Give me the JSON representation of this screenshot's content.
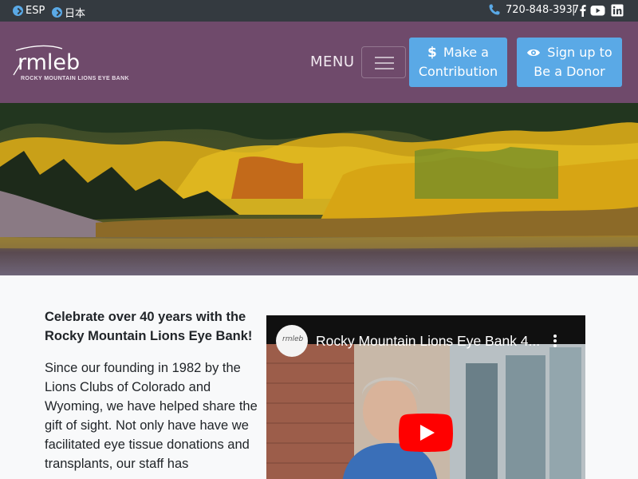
{
  "topbar": {
    "lang_esp": "ESP",
    "lang_jp": "日本",
    "phone": "720-848-3937",
    "separator": "|",
    "social": [
      "facebook-icon",
      "youtube-icon",
      "linkedin-icon"
    ]
  },
  "header": {
    "logo_text": "rmleb",
    "logo_subtitle": "ROCKY MOUNTAIN LIONS EYE BANK",
    "menu_label": "MENU",
    "contribution_line1": "Make a",
    "contribution_line2": "Contribution",
    "donor_line1": "Sign up to",
    "donor_line2": "Be a Donor"
  },
  "content": {
    "headline": "Celebrate over 40 years with the Rocky Mountain Lions Eye Bank!",
    "body": "Since our founding in 1982 by the Lions Clubs of Colorado and Wyoming, we have helped share the gift of sight. Not only have have we facilitated eye tissue donations and transplants, our staff has"
  },
  "video": {
    "title": "Rocky Mountain Lions Eye Bank 4...",
    "channel_avatar": "rmleb"
  },
  "colors": {
    "topbar": "#343a40",
    "header": "#6f4a6b",
    "button": "#5aa9e6",
    "youtube_red": "#ff0000"
  }
}
